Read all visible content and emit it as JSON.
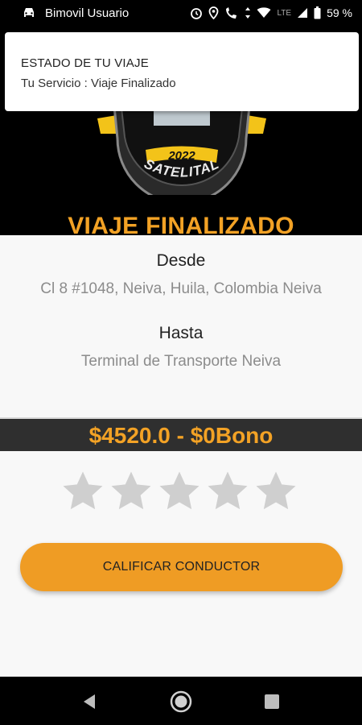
{
  "status_bar": {
    "app_name": "Bimovil Usuario",
    "battery": "59 %",
    "network": "LTE"
  },
  "notification": {
    "title": "ESTADO DE TU VIAJE",
    "body": "Tu Servicio : Viaje Finalizado"
  },
  "logo": {
    "year": "2022",
    "brand": "SATELITAL"
  },
  "trip": {
    "title": "VIAJE FINALIZADO",
    "from_label": "Desde",
    "from_address": "Cl 8 #1048, Neiva, Huila, Colombia Neiva",
    "to_label": "Hasta",
    "to_address": "Terminal de Transporte Neiva"
  },
  "price": {
    "text": "$4520.0 - $0Bono"
  },
  "rating": {
    "value": 0,
    "max": 5
  },
  "actions": {
    "rate_driver": "CALIFICAR CONDUCTOR"
  },
  "colors": {
    "accent": "#f3a225",
    "button": "#ef9c24",
    "star_empty": "#cfcfcf",
    "price_bar": "#2f2f2f"
  }
}
